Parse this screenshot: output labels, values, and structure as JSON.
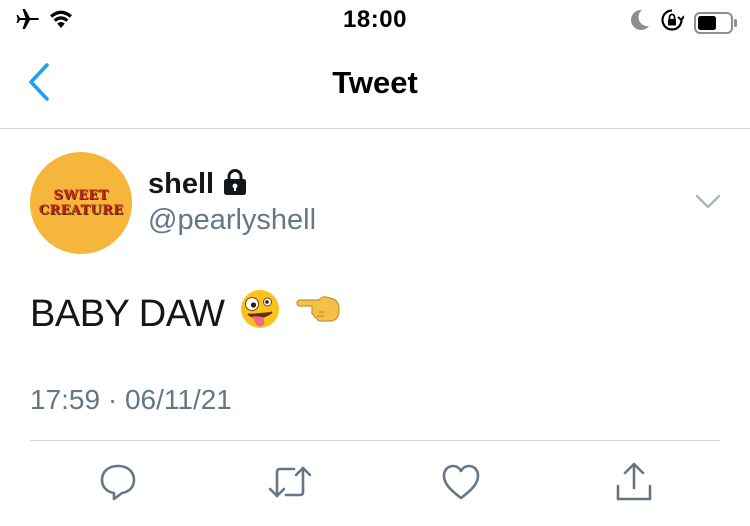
{
  "status_bar": {
    "time": "18:00",
    "icons": [
      "airplane-icon",
      "wifi-icon",
      "moon-icon",
      "orientation-lock-icon",
      "battery-icon"
    ]
  },
  "nav": {
    "title": "Tweet",
    "back_icon": "chevron-left-icon",
    "accent_color": "#1da1f2"
  },
  "tweet": {
    "avatar": {
      "line1": "SWEET",
      "line2": "CREATURE",
      "background": "#f5b63b",
      "text_color": "#c0271c"
    },
    "display_name": "shell",
    "protected_icon": "lock-icon",
    "handle": "@pearlyshell",
    "text": "BABY DAW",
    "emojis": [
      "zany-face-emoji",
      "pointing-left-emoji"
    ],
    "timestamp": "17:59 · 06/11/21",
    "more_icon": "chevron-down-icon"
  },
  "actions": {
    "icons": [
      "reply-icon",
      "retweet-icon",
      "like-icon",
      "share-icon"
    ],
    "color": "#657786"
  }
}
